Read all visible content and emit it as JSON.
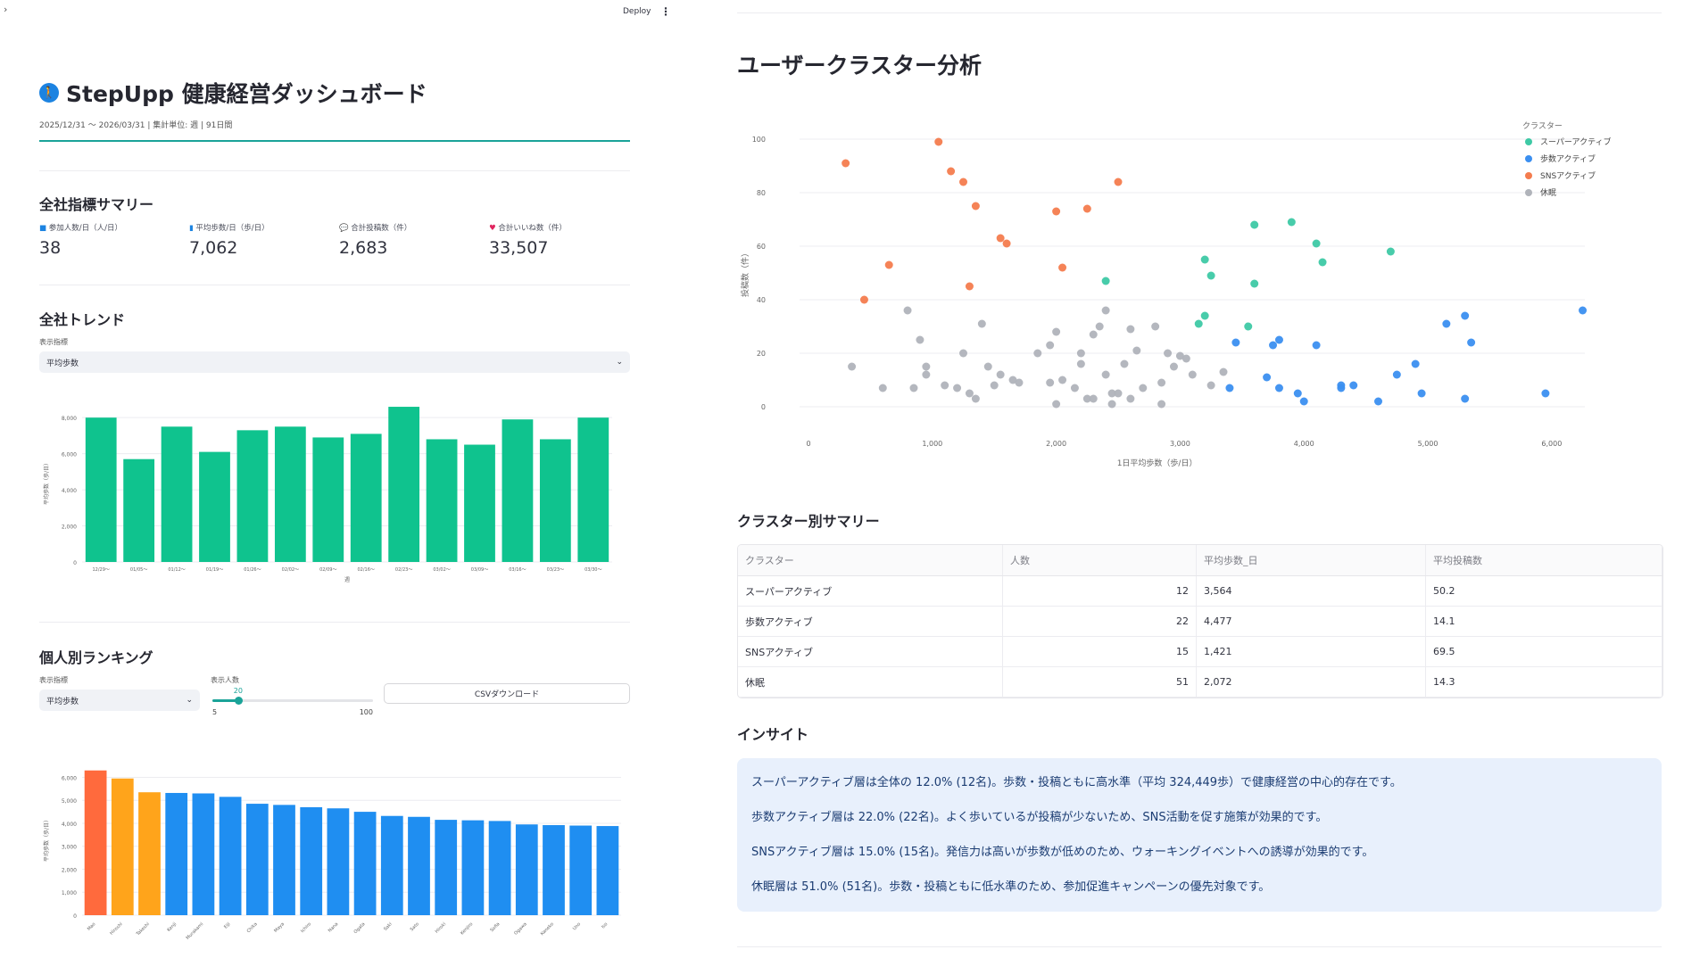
{
  "header": {
    "chevron": "›",
    "deploy_label": "Deploy",
    "menu_icon": "⋮"
  },
  "app": {
    "title": "StepUpp 健康経営ダッシュボード",
    "period": "2025/12/31 〜 2026/03/31 | 集計単位: 週 | 91日間"
  },
  "summary": {
    "heading": "全社指標サマリー",
    "metrics": [
      {
        "icon": "people-icon",
        "label": "参加人数/日（人/日）",
        "value": "38"
      },
      {
        "icon": "chart-icon",
        "label": "平均歩数/日（歩/日）",
        "value": "7,062"
      },
      {
        "icon": "speech-icon",
        "label": "合計投稿数（件）",
        "value": "2,683"
      },
      {
        "icon": "heart-icon",
        "label": "合計いいね数（件）",
        "value": "33,507"
      }
    ]
  },
  "trend": {
    "heading": "全社トレンド",
    "select_label": "表示指標",
    "select_value": "平均歩数"
  },
  "ranking": {
    "heading": "個人別ランキング",
    "select_label": "表示指標",
    "select_value": "平均歩数",
    "slider_label": "表示人数",
    "slider_value": "20",
    "slider_min": "5",
    "slider_max": "100",
    "slider_fraction": 0.16,
    "download_label": "CSVダウンロード"
  },
  "cluster": {
    "heading": "ユーザークラスター分析",
    "summary_heading": "クラスター別サマリー",
    "columns": [
      "クラスター",
      "人数",
      "平均歩数_日",
      "平均投稿数"
    ],
    "rows": [
      [
        "スーパーアクティブ",
        "12",
        "3,564",
        "50.2"
      ],
      [
        "歩数アクティブ",
        "22",
        "4,477",
        "14.1"
      ],
      [
        "SNSアクティブ",
        "15",
        "1,421",
        "69.5"
      ],
      [
        "休眠",
        "51",
        "2,072",
        "14.3"
      ]
    ]
  },
  "insight": {
    "heading": "インサイト",
    "lines": [
      "スーパーアクティブ層は全体の 12.0% (12名)。歩数・投稿ともに高水準（平均 324,449歩）で健康経営の中心的存在です。",
      "歩数アクティブ層は 22.0% (22名)。よく歩いているが投稿が少ないため、SNS活動を促す施策が効果的です。",
      "SNSアクティブ層は 15.0% (15名)。発信力は高いが歩数が低めのため、ウォーキングイベントへの誘導が効果的です。",
      "休眠層は 51.0% (51名)。歩数・投稿ともに低水準のため、参加促進キャンペーンの優先対象です。"
    ]
  },
  "colors": {
    "accent": "#1aa398",
    "bar_green": "#0fc38e",
    "rank_top": "#ff6a3d",
    "rank_2_3": "#ffa41b",
    "rank_rest": "#1f8ef1",
    "super": "#3ec9a5",
    "steps": "#3b8ff0",
    "sns": "#f47c4e",
    "dormant": "#b0b3ba",
    "insight_bg": "#e8f0fc"
  },
  "chart_data": [
    {
      "type": "bar",
      "title": "",
      "xlabel": "週",
      "ylabel": "平均歩数（歩/日）",
      "ylim": [
        0,
        8800
      ],
      "yticks": [
        "0",
        "2,000",
        "4,000",
        "6,000",
        "8,000"
      ],
      "categories": [
        "12/29〜",
        "01/05〜",
        "01/12〜",
        "01/19〜",
        "01/26〜",
        "02/02〜",
        "02/09〜",
        "02/16〜",
        "02/23〜",
        "03/02〜",
        "03/09〜",
        "03/16〜",
        "03/23〜",
        "03/30〜"
      ],
      "values": [
        8000,
        5700,
        7500,
        6100,
        7300,
        7500,
        6900,
        7100,
        8600,
        6800,
        6500,
        7900,
        6800,
        8000
      ]
    },
    {
      "type": "bar",
      "title": "",
      "xlabel": "",
      "ylabel": "平均歩数（歩/日）",
      "ylim": [
        0,
        6600
      ],
      "yticks": [
        "0",
        "1,000",
        "2,000",
        "3,000",
        "4,000",
        "5,000",
        "6,000"
      ],
      "categories": [
        "Mao",
        "Hiroshi",
        "Takeshi",
        "Kenji",
        "Murakami",
        "Eiji",
        "Chika",
        "Maya",
        "Ichiro",
        "Nana",
        "Ogata",
        "Saki",
        "Sato",
        "Hiroki",
        "Kenjiro",
        "Sofia",
        "Ogawa",
        "Kaneko",
        "Uno",
        "Iso"
      ],
      "values": [
        6300,
        5950,
        5350,
        5320,
        5300,
        5150,
        4850,
        4800,
        4700,
        4650,
        4500,
        4320,
        4280,
        4150,
        4130,
        4100,
        3950,
        3920,
        3900,
        3880
      ]
    },
    {
      "type": "scatter",
      "title": "",
      "xlabel": "1日平均歩数（歩/日）",
      "ylabel": "投稿数（件）",
      "xlim": [
        0,
        6700
      ],
      "ylim": [
        0,
        100
      ],
      "xticks": [
        "0",
        "1,000",
        "2,000",
        "3,000",
        "4,000",
        "5,000",
        "6,000"
      ],
      "yticks": [
        "0",
        "20",
        "40",
        "60",
        "80",
        "100"
      ],
      "legend_title": "クラスター",
      "legend_position": "top-right",
      "series": [
        {
          "name": "スーパーアクティブ",
          "points": [
            [
              2400,
              47
            ],
            [
              3200,
              55
            ],
            [
              3250,
              49
            ],
            [
              3600,
              68
            ],
            [
              3900,
              69
            ],
            [
              4100,
              61
            ],
            [
              4150,
              54
            ],
            [
              4700,
              58
            ],
            [
              3600,
              46
            ],
            [
              3200,
              34
            ],
            [
              3150,
              31
            ],
            [
              3550,
              30
            ]
          ]
        },
        {
          "name": "歩数アクティブ",
          "points": [
            [
              3450,
              24
            ],
            [
              3750,
              23
            ],
            [
              3800,
              25
            ],
            [
              4100,
              23
            ],
            [
              4300,
              8
            ],
            [
              3400,
              7
            ],
            [
              3700,
              11
            ],
            [
              3800,
              7
            ],
            [
              3950,
              5
            ],
            [
              4000,
              2
            ],
            [
              4300,
              7
            ],
            [
              4400,
              8
            ],
            [
              4750,
              12
            ],
            [
              4900,
              16
            ],
            [
              4950,
              5
            ],
            [
              5150,
              31
            ],
            [
              5300,
              34
            ],
            [
              5350,
              24
            ],
            [
              5300,
              3
            ],
            [
              5950,
              5
            ],
            [
              6250,
              36
            ],
            [
              4600,
              2
            ]
          ]
        },
        {
          "name": "SNSアクティブ",
          "points": [
            [
              300,
              91
            ],
            [
              1050,
              99
            ],
            [
              1150,
              88
            ],
            [
              1250,
              84
            ],
            [
              1350,
              75
            ],
            [
              1550,
              63
            ],
            [
              1600,
              61
            ],
            [
              2000,
              73
            ],
            [
              2250,
              74
            ],
            [
              2500,
              84
            ],
            [
              650,
              53
            ],
            [
              450,
              40
            ],
            [
              1300,
              45
            ],
            [
              2050,
              52
            ]
          ]
        },
        {
          "name": "休眠",
          "points": [
            [
              350,
              15
            ],
            [
              800,
              36
            ],
            [
              900,
              25
            ],
            [
              950,
              15
            ],
            [
              600,
              7
            ],
            [
              1250,
              20
            ],
            [
              1300,
              5
            ],
            [
              1400,
              31
            ],
            [
              1500,
              8
            ],
            [
              1550,
              12
            ],
            [
              1650,
              10
            ],
            [
              1700,
              9
            ],
            [
              1850,
              20
            ],
            [
              1950,
              23
            ],
            [
              2000,
              28
            ],
            [
              2050,
              10
            ],
            [
              2150,
              7
            ],
            [
              2200,
              20
            ],
            [
              2300,
              27
            ],
            [
              2350,
              30
            ],
            [
              2400,
              36
            ],
            [
              2450,
              5
            ],
            [
              2550,
              16
            ],
            [
              2600,
              29
            ],
            [
              2650,
              21
            ],
            [
              2700,
              7
            ],
            [
              2800,
              30
            ],
            [
              2850,
              9
            ],
            [
              2950,
              15
            ],
            [
              3050,
              18
            ],
            [
              3100,
              12
            ],
            [
              3250,
              8
            ],
            [
              3350,
              13
            ],
            [
              2450,
              1
            ],
            [
              2600,
              3
            ],
            [
              2850,
              1
            ],
            [
              2000,
              1
            ],
            [
              2250,
              3
            ],
            [
              1350,
              3
            ],
            [
              850,
              7
            ],
            [
              1100,
              8
            ],
            [
              1200,
              7
            ],
            [
              2400,
              12
            ],
            [
              1950,
              9
            ],
            [
              2200,
              16
            ],
            [
              2500,
              5
            ],
            [
              2900,
              20
            ],
            [
              3000,
              19
            ],
            [
              2300,
              3
            ],
            [
              1450,
              15
            ],
            [
              950,
              12
            ]
          ]
        }
      ]
    }
  ]
}
